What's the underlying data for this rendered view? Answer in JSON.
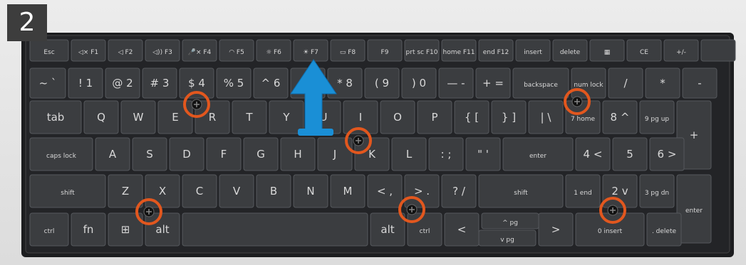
{
  "step_number": "2",
  "colors": {
    "screw_ring": "#e2571e",
    "arrow": "#1a8fd6",
    "key_face": "#3b3d40",
    "key_text": "#d8d8d8",
    "deck": "#1c1d1f"
  },
  "rows": [
    {
      "keys": [
        {
          "n": "esc",
          "t": "Esc"
        },
        {
          "n": "f1",
          "t": "◁× F1"
        },
        {
          "n": "f2",
          "t": "◁ F2"
        },
        {
          "n": "f3",
          "t": "◁)) F3"
        },
        {
          "n": "f4",
          "t": "🎤× F4"
        },
        {
          "n": "f5",
          "t": "◠ F5"
        },
        {
          "n": "f6",
          "t": "☼ F6"
        },
        {
          "n": "f7",
          "t": "☀ F7"
        },
        {
          "n": "f8",
          "t": "▭ F8"
        },
        {
          "n": "f9",
          "t": "F9"
        },
        {
          "n": "f10",
          "t": "prt sc F10"
        },
        {
          "n": "f11",
          "t": "home F11"
        },
        {
          "n": "f12",
          "t": "end F12"
        },
        {
          "n": "insert",
          "t": "insert"
        },
        {
          "n": "delete",
          "t": "delete"
        },
        {
          "n": "calc",
          "t": "▦"
        },
        {
          "n": "ce",
          "t": "CE"
        },
        {
          "n": "plusminus",
          "t": "+/-"
        },
        {
          "n": "power",
          "t": ""
        }
      ]
    },
    {
      "keys": [
        {
          "n": "tilde",
          "t": "~ `"
        },
        {
          "n": "1",
          "t": "! 1"
        },
        {
          "n": "2",
          "t": "@ 2"
        },
        {
          "n": "3",
          "t": "# 3"
        },
        {
          "n": "4",
          "t": "$ 4"
        },
        {
          "n": "5",
          "t": "% 5"
        },
        {
          "n": "6",
          "t": "^ 6"
        },
        {
          "n": "7",
          "t": "& 7"
        },
        {
          "n": "8",
          "t": "* 8"
        },
        {
          "n": "9",
          "t": "( 9"
        },
        {
          "n": "0",
          "t": ") 0"
        },
        {
          "n": "minus",
          "t": "— -"
        },
        {
          "n": "equals",
          "t": "+ ="
        },
        {
          "n": "backspace",
          "t": "backspace"
        },
        {
          "n": "numlock",
          "t": "num lock"
        },
        {
          "n": "slash",
          "t": "/"
        },
        {
          "n": "asterisk",
          "t": "*"
        },
        {
          "n": "numminus",
          "t": "-"
        }
      ]
    },
    {
      "keys": [
        {
          "n": "tab",
          "t": "tab"
        },
        {
          "n": "q",
          "t": "Q"
        },
        {
          "n": "w",
          "t": "W"
        },
        {
          "n": "e",
          "t": "E"
        },
        {
          "n": "r",
          "t": "R"
        },
        {
          "n": "t",
          "t": "T"
        },
        {
          "n": "y",
          "t": "Y"
        },
        {
          "n": "u",
          "t": "U"
        },
        {
          "n": "i",
          "t": "I"
        },
        {
          "n": "o",
          "t": "O"
        },
        {
          "n": "p",
          "t": "P"
        },
        {
          "n": "lbrace",
          "t": "{ ["
        },
        {
          "n": "rbrace",
          "t": "} ]"
        },
        {
          "n": "backslash",
          "t": "| \\"
        },
        {
          "n": "num7",
          "t": "7 home"
        },
        {
          "n": "num8",
          "t": "8 ^"
        },
        {
          "n": "num9",
          "t": "9 pg up"
        },
        {
          "n": "numplus",
          "t": "+"
        }
      ]
    },
    {
      "keys": [
        {
          "n": "capslock",
          "t": "caps lock"
        },
        {
          "n": "a",
          "t": "A"
        },
        {
          "n": "s",
          "t": "S"
        },
        {
          "n": "d",
          "t": "D"
        },
        {
          "n": "f",
          "t": "F"
        },
        {
          "n": "g",
          "t": "G"
        },
        {
          "n": "h",
          "t": "H"
        },
        {
          "n": "j",
          "t": "J"
        },
        {
          "n": "k",
          "t": "K"
        },
        {
          "n": "l",
          "t": "L"
        },
        {
          "n": "semicolon",
          "t": ": ;"
        },
        {
          "n": "quote",
          "t": "\" '"
        },
        {
          "n": "enter",
          "t": "enter"
        },
        {
          "n": "num4",
          "t": "4 <"
        },
        {
          "n": "num5",
          "t": "5"
        },
        {
          "n": "num6",
          "t": "6 >"
        }
      ]
    },
    {
      "keys": [
        {
          "n": "lshift",
          "t": "shift"
        },
        {
          "n": "z",
          "t": "Z"
        },
        {
          "n": "x",
          "t": "X"
        },
        {
          "n": "c",
          "t": "C"
        },
        {
          "n": "v",
          "t": "V"
        },
        {
          "n": "b",
          "t": "B"
        },
        {
          "n": "n",
          "t": "N"
        },
        {
          "n": "m",
          "t": "M"
        },
        {
          "n": "comma",
          "t": "< ,"
        },
        {
          "n": "period",
          "t": "> ."
        },
        {
          "n": "question",
          "t": "? /"
        },
        {
          "n": "rshift",
          "t": "shift"
        },
        {
          "n": "num1",
          "t": "1 end"
        },
        {
          "n": "num2",
          "t": "2 v"
        },
        {
          "n": "num3",
          "t": "3 pg dn"
        },
        {
          "n": "numenter",
          "t": "enter"
        }
      ]
    },
    {
      "keys": [
        {
          "n": "ctrl",
          "t": "ctrl"
        },
        {
          "n": "fn",
          "t": "fn"
        },
        {
          "n": "win",
          "t": "⊞"
        },
        {
          "n": "alt",
          "t": "alt"
        },
        {
          "n": "space",
          "t": ""
        },
        {
          "n": "ralt",
          "t": "alt"
        },
        {
          "n": "rctrl",
          "t": "ctrl"
        },
        {
          "n": "left",
          "t": "<"
        },
        {
          "n": "uppg",
          "t": "^ pg"
        },
        {
          "n": "downpg",
          "t": "v pg"
        },
        {
          "n": "right",
          "t": ">"
        },
        {
          "n": "num0",
          "t": "0 insert"
        },
        {
          "n": "numdel",
          "t": ". delete"
        }
      ]
    }
  ],
  "screws": [
    "screw-1",
    "screw-2",
    "screw-3",
    "screw-4",
    "screw-5",
    "screw-6"
  ]
}
